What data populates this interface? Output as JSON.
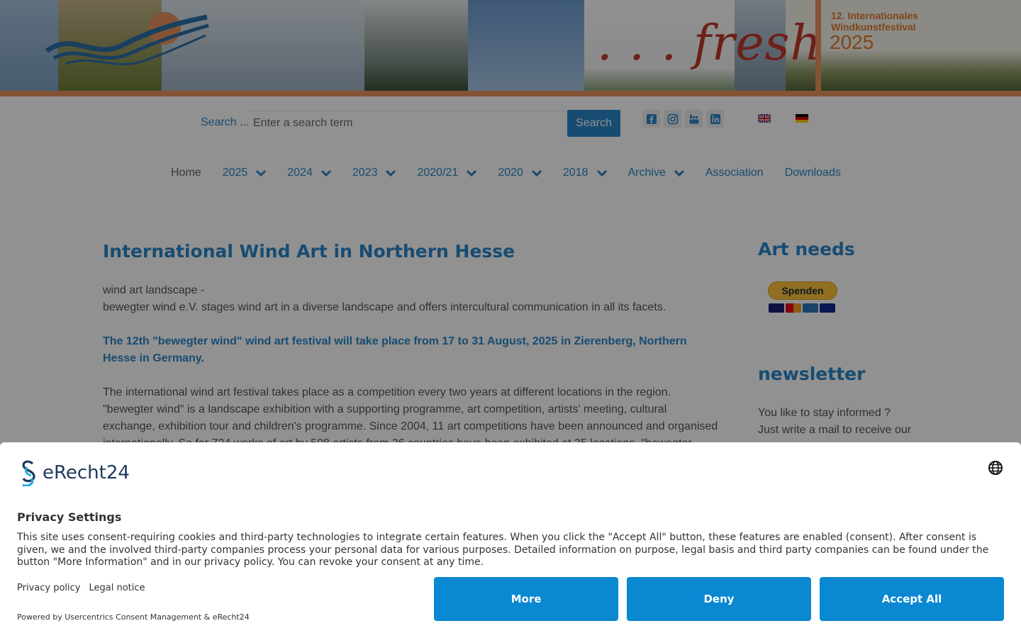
{
  "banner": {
    "fresh_text": ". . . fresh",
    "festival_line1": "12. Internationales",
    "festival_line2": "Windkunstfestival",
    "festival_year": "2025",
    "accent_color": "#e8935e"
  },
  "search": {
    "label": "Search ...",
    "placeholder": "Enter a search term",
    "value": "",
    "button_label": "Search"
  },
  "social_icons": [
    "facebook-icon",
    "instagram-icon",
    "youtube-icon",
    "linkedin-icon"
  ],
  "languages": [
    "english-flag",
    "german-flag"
  ],
  "nav": {
    "items": [
      {
        "label": "Home",
        "has_dropdown": false
      },
      {
        "label": "2025",
        "has_dropdown": true
      },
      {
        "label": "2024",
        "has_dropdown": true
      },
      {
        "label": "2023",
        "has_dropdown": true
      },
      {
        "label": "2020/21",
        "has_dropdown": true
      },
      {
        "label": "2020",
        "has_dropdown": true
      },
      {
        "label": "2018",
        "has_dropdown": true
      },
      {
        "label": "Archive",
        "has_dropdown": true
      },
      {
        "label": "Association",
        "has_dropdown": false
      },
      {
        "label": "Downloads",
        "has_dropdown": false
      }
    ]
  },
  "main": {
    "title": "International Wind Art in Northern Hesse",
    "intro_line1": "wind art landscape -",
    "intro_line2": "bewegter wind e.V. stages wind art in a diverse landscape and offers intercultural communication in all its facets.",
    "highlight": "The 12th \"bewegter wind\" wind art festival will take place from 17 to 31 August, 2025 in Zierenberg, Northern Hesse in Germany.",
    "body": "The international wind art festival takes place as a competition every two years at different locations in the region. \"bewegter wind\" is a landscape exhibition with a supporting programme, art competition, artists' meeting, cultural exchange, exhibition tour and children's programme. Since 2004, 11 art competitions have been announced and organised internationally. So far 724 works of art by 508 artists from 36 countries have been exhibited at 35 locations. \"bewegter wind\" stages wind art in a"
  },
  "sidebar": {
    "art_heading": "Art needs",
    "donate_label": "Spenden",
    "newsletter_heading": "newsletter",
    "newsletter_line1": "You like to stay informed ?",
    "newsletter_line2": "Just write a mail to receive our"
  },
  "consent": {
    "brand": "eRecht24",
    "title": "Privacy Settings",
    "text": "This site uses consent-requiring cookies and third-party technologies to integrate certain features. When you click the \"Accept All\" button, these features are enabled (consent). After consent is given, we and the involved third-party companies process your personal data for various purposes. Detailed information on purpose, legal basis and third party companies can be found under the button \"More Information\" and in our privacy policy. You can revoke your consent at any time.",
    "privacy_link": "Privacy policy",
    "legal_link": "Legal notice",
    "powered_by": "Powered by Usercentrics Consent Management & eRecht24",
    "more_label": "More",
    "deny_label": "Deny",
    "accept_label": "Accept All",
    "button_color": "#0a88d1"
  }
}
